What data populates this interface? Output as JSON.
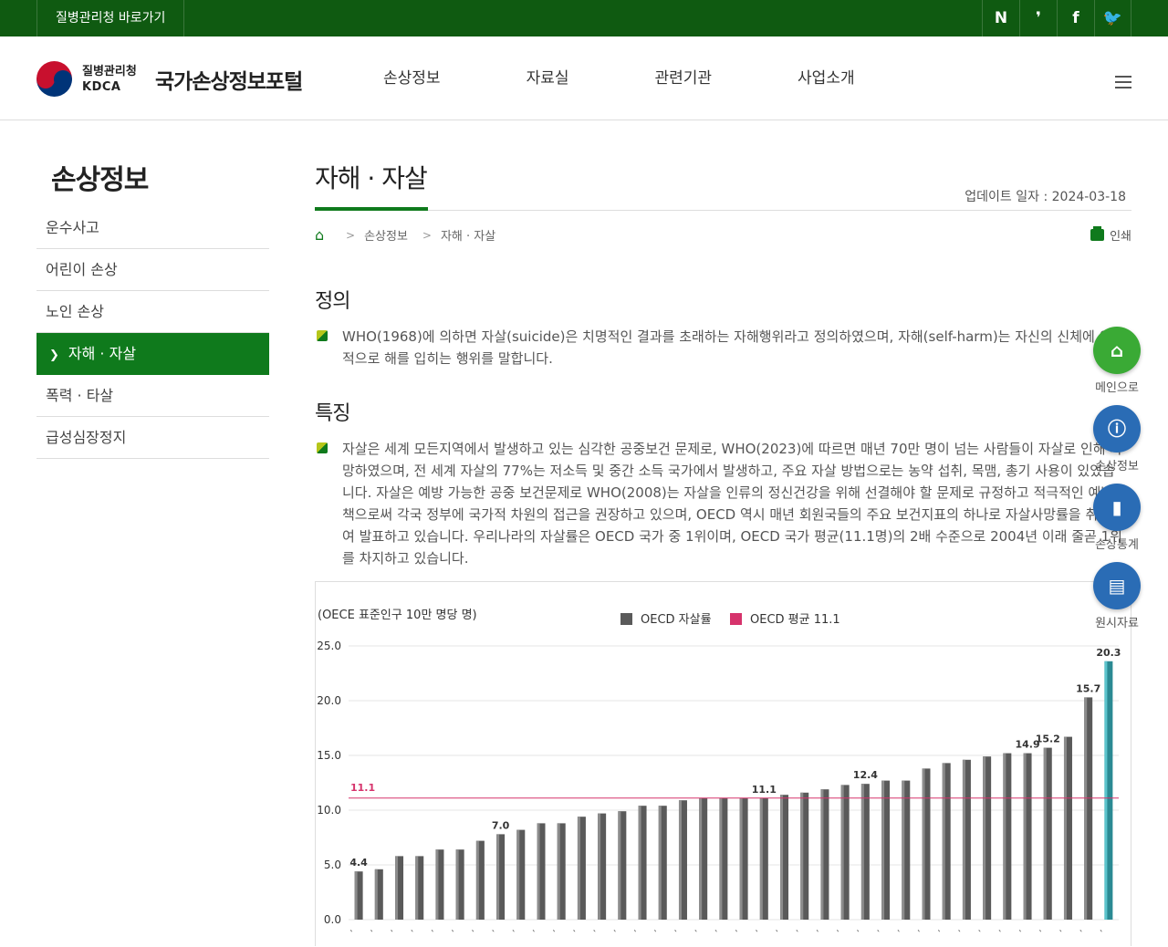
{
  "topbar": {
    "kdca_link": "질병관리청 바로가기",
    "sns": [
      {
        "icon": "naver-blog-icon",
        "glyph": "N"
      },
      {
        "icon": "kakao-icon",
        "glyph": "❜"
      },
      {
        "icon": "facebook-icon",
        "glyph": "f"
      },
      {
        "icon": "twitter-icon",
        "glyph": "🐦"
      }
    ]
  },
  "header": {
    "logo_ko": "질병관리청",
    "logo_en": "KDCA",
    "portal_title": "국가손상정보포털",
    "gnb": [
      "손상정보",
      "자료실",
      "관련기관",
      "사업소개"
    ]
  },
  "lnb": {
    "title": "손상정보",
    "items": [
      {
        "label": "운수사고",
        "active": false
      },
      {
        "label": "어린이 손상",
        "active": false
      },
      {
        "label": "노인 손상",
        "active": false
      },
      {
        "label": "자해 · 자살",
        "active": true
      },
      {
        "label": "폭력 · 타살",
        "active": false
      },
      {
        "label": "급성심장정지",
        "active": false
      }
    ]
  },
  "content": {
    "title": "자해 · 자살",
    "update": "업데이트 일자 : 2024-03-18",
    "breadcrumb": [
      "손상정보",
      "자해 · 자살"
    ],
    "print": "인쇄",
    "definition_title": "정의",
    "definition_text": "WHO(1968)에 의하면 자살(suicide)은 치명적인 결과를 초래하는 자해행위라고 정의하였으며, 자해(self-harm)는 자신의 신체에 의도적으로 해를 입히는 행위를 말합니다.",
    "feature_title": "특징",
    "feature_text": "자살은 세계 모든지역에서 발생하고 있는 심각한 공중보건 문제로, WHO(2023)에 따르면 매년 70만 명이 넘는 사람들이 자살로 인해 사망하였으며, 전 세계 자살의 77%는 저소득 및 중간 소득 국가에서 발생하고, 주요 자살 방법으로는 농약 섭취, 목맴, 총기 사용이 있었습니다. 자살은 예방 가능한 공중 보건문제로 WHO(2008)는 자살을 인류의 정신건강을 위해 선결해야 할 문제로 규정하고 적극적인 예방대책으로써 각국 정부에 국가적 차원의 접근을 권장하고 있으며, OECD 역시 매년 회원국들의 주요 보건지표의 하나로 자살사망률을 취합하여 발표하고 있습니다. 우리나라의 자살률은 OECD 국가 중 1위이며, OECD 국가 평균(11.1명)의 2배 수준으로 2004년 이래 줄곧 1위를 차지하고 있습니다."
  },
  "quick_menu": [
    {
      "label": "메인으로",
      "icon": "home-icon",
      "glyph": "⌂",
      "color": "#3aaa35"
    },
    {
      "label": "손상정보",
      "icon": "alert-icon",
      "glyph": "ⓘ",
      "color": "#2a6cb5"
    },
    {
      "label": "손상통계",
      "icon": "bar-chart-icon",
      "glyph": "▮",
      "color": "#2a6cb5"
    },
    {
      "label": "원시자료",
      "icon": "document-icon",
      "glyph": "▤",
      "color": "#2a6cb5"
    }
  ],
  "chart_data": {
    "type": "bar",
    "ylabel": "(OECE 표준인구 10만 명당 명)",
    "ylim": [
      0,
      25
    ],
    "yticks": [
      "0.0",
      "5.0",
      "10.0",
      "15.0",
      "20.0",
      "25.0"
    ],
    "legend": [
      {
        "name": "OECD 자살률",
        "color": "#5a5a5a"
      },
      {
        "name": "OECD 평균 11.1",
        "color": "#d6336c"
      }
    ],
    "legend_position": "top-center",
    "average_line": 11.1,
    "average_label": "11.1",
    "values": [
      4.4,
      4.6,
      5.8,
      5.8,
      6.4,
      6.4,
      7.2,
      7.8,
      8.2,
      8.8,
      8.8,
      9.4,
      9.7,
      9.9,
      10.4,
      10.4,
      10.9,
      11.1,
      11.1,
      11.1,
      11.1,
      11.4,
      11.6,
      11.9,
      12.3,
      12.4,
      12.7,
      12.7,
      13.8,
      14.3,
      14.6,
      14.9,
      15.2,
      15.2,
      15.7,
      16.7,
      20.3,
      23.6
    ],
    "data_labels": {
      "0": "4.4",
      "7": "7.0",
      "20": "11.1",
      "25": "12.4",
      "33": "14.9",
      "34": "15.2",
      "36": "15.7",
      "37": "20.3",
      "38": "23.6"
    },
    "highlight_index": 38
  }
}
